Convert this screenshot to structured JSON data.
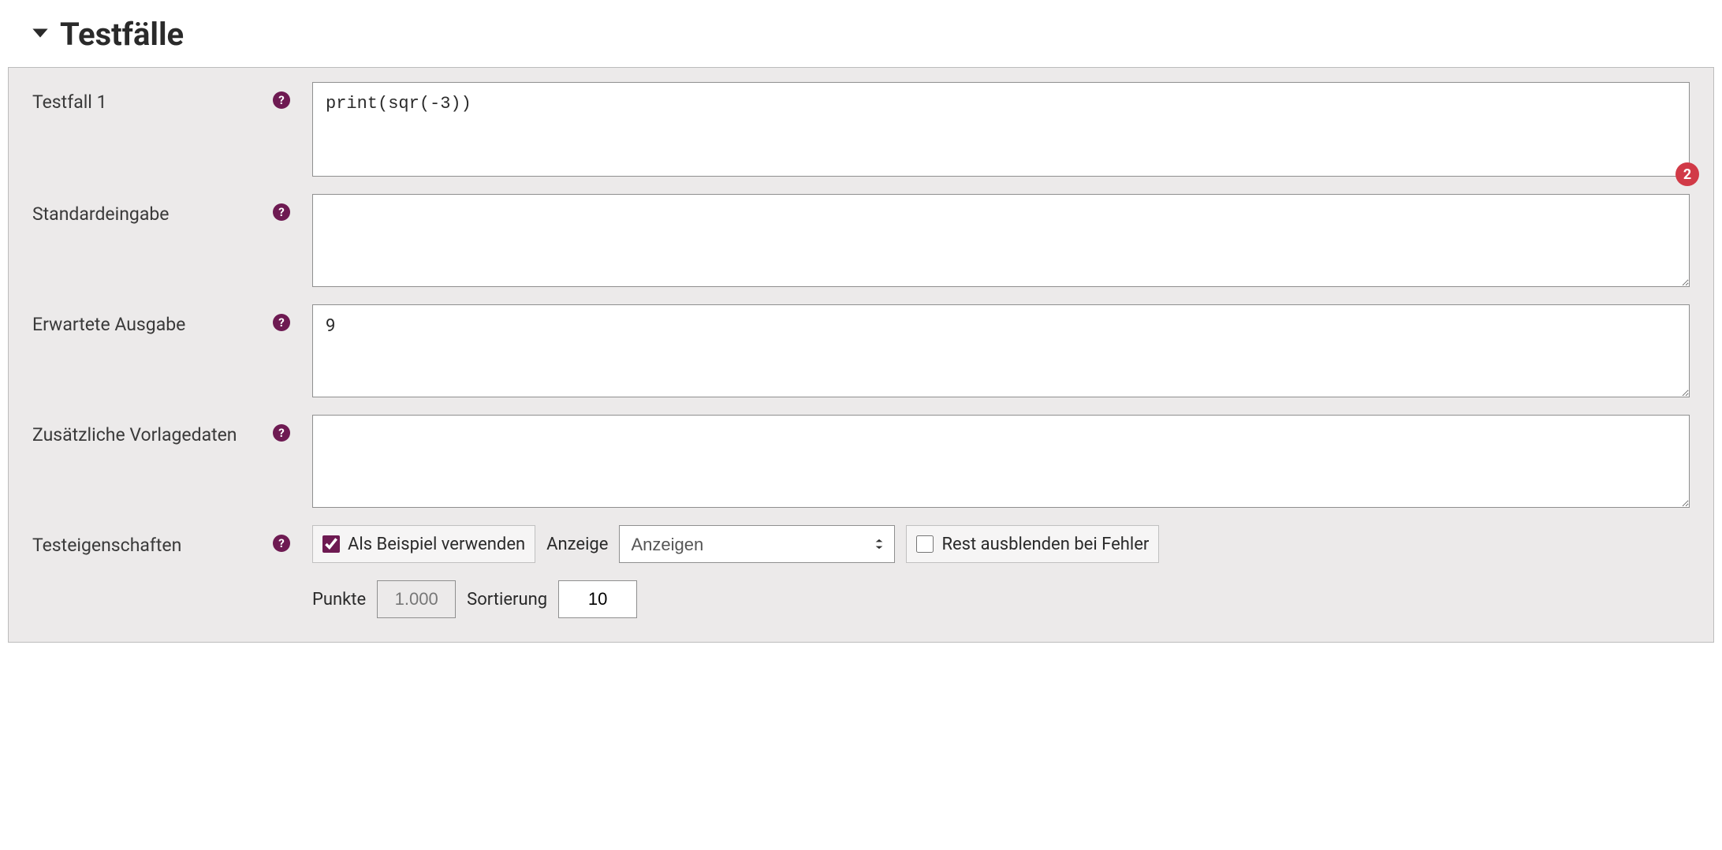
{
  "section": {
    "title": "Testfälle"
  },
  "fields": {
    "testcase": {
      "label": "Testfall 1",
      "value": "print(sqr(-3))",
      "badge": "2"
    },
    "stdin": {
      "label": "Standardeingabe",
      "value": ""
    },
    "expected": {
      "label": "Erwartete Ausgabe",
      "value": "9"
    },
    "extra": {
      "label": "Zusätzliche Vorlagedaten",
      "value": ""
    },
    "props": {
      "label": "Testeigenschaften"
    }
  },
  "props": {
    "use_as_example_label": "Als Beispiel verwenden",
    "use_as_example_checked": true,
    "display_label": "Anzeige",
    "display_selected": "Anzeigen",
    "hide_rest_label": "Rest ausblenden bei Fehler",
    "hide_rest_checked": false,
    "points_label": "Punkte",
    "points_value": "1.000",
    "order_label": "Sortierung",
    "order_value": "10"
  }
}
